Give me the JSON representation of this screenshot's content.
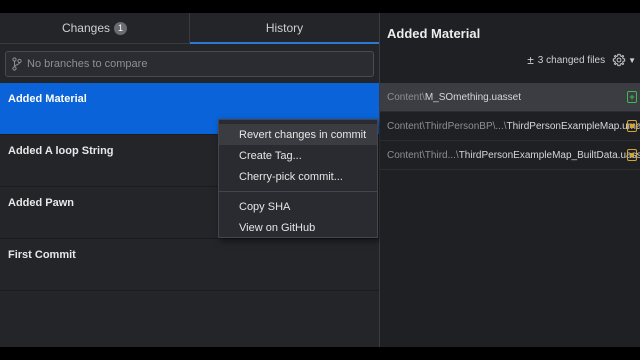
{
  "tabs": {
    "changes_label": "Changes",
    "changes_count": "1",
    "history_label": "History"
  },
  "branch_compare": {
    "placeholder": "No branches to compare"
  },
  "commits": [
    {
      "title": "Added Material"
    },
    {
      "title": "Added A loop String"
    },
    {
      "title": "Added Pawn"
    },
    {
      "title": "First Commit"
    }
  ],
  "context_menu": {
    "items": [
      "Revert changes in commit",
      "Create Tag...",
      "Cherry-pick commit...",
      "Copy SHA",
      "View on GitHub"
    ]
  },
  "detail": {
    "title": "Added Material",
    "changed_files_label": "3 changed files",
    "files": [
      {
        "dir": "Content\\",
        "name": "M_SOmething.uasset",
        "status": "added"
      },
      {
        "dir": "Content\\ThirdPersonBP\\...\\",
        "name": "ThirdPersonExampleMap.umap",
        "status": "modified"
      },
      {
        "dir": "Content\\Third...\\",
        "name": "ThirdPersonExampleMap_BuiltData.uasset",
        "status": "modified"
      }
    ]
  },
  "colors": {
    "accent": "#0a63d8",
    "tab_underline": "#2b7bd6",
    "added": "#3fb950",
    "modified": "#d4a72c"
  }
}
